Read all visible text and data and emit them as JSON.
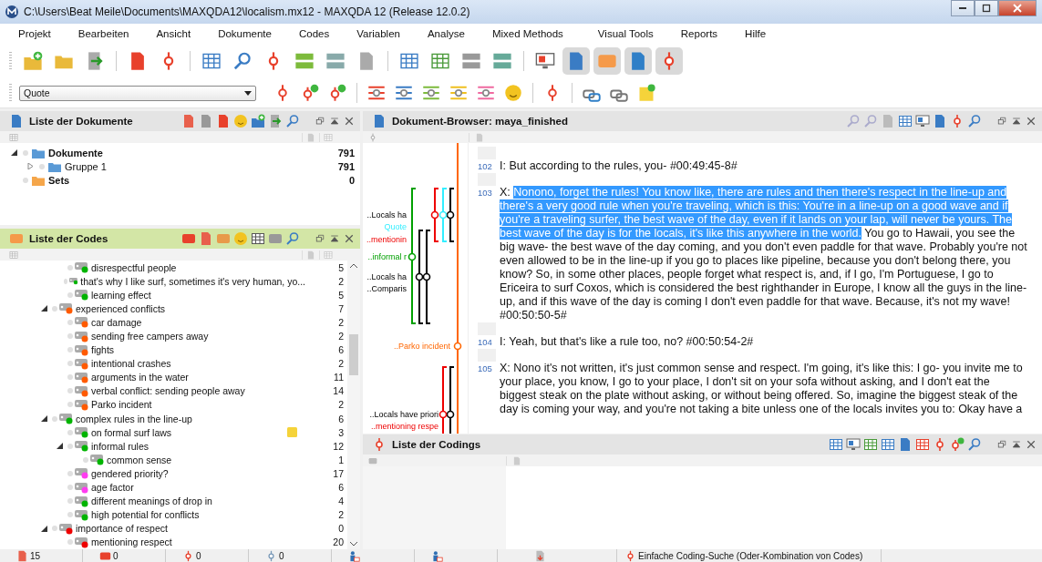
{
  "window": {
    "title": "C:\\Users\\Beat Meile\\Documents\\MAXQDA12\\localism.mx12 - MAXQDA 12  (Release 12.0.2)"
  },
  "menu": [
    "Projekt",
    "Bearbeiten",
    "Ansicht",
    "Dokumente",
    "Codes",
    "Variablen",
    "Analyse",
    "Mixed Methods",
    "Visual Tools",
    "Reports",
    "Hilfe"
  ],
  "toolbar": [
    {
      "pressed": false
    },
    {
      "pressed": false
    },
    {
      "pressed": false
    },
    {
      "pressed": false
    },
    {
      "pressed": false
    },
    {
      "pressed": false
    },
    {
      "pressed": false
    },
    {
      "pressed": false
    },
    {
      "pressed": false
    },
    {
      "pressed": false
    },
    {
      "pressed": false
    },
    {
      "pressed": false
    },
    {
      "pressed": false
    },
    {
      "pressed": false
    },
    {
      "pressed": false
    },
    {
      "pressed": false
    },
    {
      "pressed": true
    },
    {
      "pressed": true
    },
    {
      "pressed": true
    },
    {
      "pressed": true
    }
  ],
  "style_dropdown": {
    "value": "Quote"
  },
  "documents_panel": {
    "title": "Liste der Dokumente",
    "tree": [
      {
        "name": "Dokumente",
        "count": "791",
        "expanded": true,
        "children": [
          {
            "name": "Gruppe 1",
            "count": "791",
            "expanded": false
          }
        ]
      },
      {
        "name": "Sets",
        "count": "0"
      }
    ]
  },
  "codes_panel": {
    "title": "Liste der Codes",
    "leading_items": [
      {
        "name": "disrespectful people",
        "count": "5",
        "color": "#00b400",
        "memo": false
      },
      {
        "name": "that's why I like surf, sometimes it's very human, yo...",
        "count": "2",
        "color": "#00b400",
        "memo": false
      },
      {
        "name": "learning effect",
        "count": "5",
        "color": "#00b400",
        "memo": false
      }
    ],
    "tree": [
      {
        "name": "experienced conflicts",
        "count": "7",
        "color": "#ff5a00",
        "memo": false,
        "expanded": true,
        "children": [
          {
            "name": "car damage",
            "count": "2",
            "color": "#ff5a00",
            "memo": false
          },
          {
            "name": "sending free campers away",
            "count": "2",
            "color": "#ff5a00",
            "memo": false
          },
          {
            "name": "fights",
            "count": "6",
            "color": "#ff5a00",
            "memo": false
          },
          {
            "name": "intentional crashes",
            "count": "2",
            "color": "#ff5a00",
            "memo": false
          },
          {
            "name": "arguments in the water",
            "count": "11",
            "color": "#ff5a00",
            "memo": false
          },
          {
            "name": "verbal conflict: sending people away",
            "count": "14",
            "color": "#ff5a00",
            "memo": false
          },
          {
            "name": "Parko incident",
            "count": "2",
            "color": "#ff5a00",
            "memo": false
          }
        ]
      },
      {
        "name": "complex rules in the line-up",
        "count": "6",
        "color": "#00b400",
        "memo": false,
        "expanded": true,
        "children": [
          {
            "name": "on formal surf laws",
            "count": "3",
            "color": "#00b400",
            "memo": true
          },
          {
            "name": "informal rules",
            "count": "12",
            "color": "#00b400",
            "memo": false,
            "expanded": true,
            "children": [
              {
                "name": "common sense",
                "count": "1",
                "color": "#00b400",
                "memo": false
              }
            ]
          },
          {
            "name": "gendered priority?",
            "count": "17",
            "color": "#ff3cf0",
            "memo": false
          },
          {
            "name": "age factor",
            "count": "6",
            "color": "#ff3cf0",
            "memo": false
          },
          {
            "name": "different meanings of drop in",
            "count": "4",
            "color": "#00b400",
            "memo": false
          },
          {
            "name": "high potential for conflicts",
            "count": "2",
            "color": "#00b400",
            "memo": false
          }
        ]
      },
      {
        "name": "importance of respect",
        "count": "0",
        "color": "#ee0000",
        "memo": false,
        "expanded": true,
        "children": [
          {
            "name": "mentioning respect",
            "count": "20",
            "color": "#ee0000",
            "memo": false
          }
        ]
      }
    ]
  },
  "browser_panel": {
    "title": "Dokument-Browser: maya_finished",
    "coding_stripes": [
      {
        "label": "..Locals ha",
        "color": "#000000"
      },
      {
        "label": "Quote",
        "color": "#33eeff"
      },
      {
        "label": "..mentionin",
        "color": "#ee0000"
      },
      {
        "label": "..informal r",
        "color": "#00a000"
      },
      {
        "label": "..Locals ha",
        "color": "#000000"
      },
      {
        "label": "..Comparis",
        "color": "#000000"
      },
      {
        "label": "..Parko incident",
        "color": "#ff6600"
      },
      {
        "label": "..Locals have priori",
        "color": "#000000"
      },
      {
        "label": "..mentioning respe",
        "color": "#ee0000"
      }
    ],
    "paragraphs": [
      {
        "number": "102",
        "segments": [
          {
            "text": "I: But according to the rules, you- #00:49:45-8#",
            "selected": false
          }
        ]
      },
      {
        "number": "103",
        "segments": [
          {
            "text": "X: ",
            "selected": false
          },
          {
            "text": "Nonono, forget the rules! You know like, there are rules and then there's respect in the line-up and there's a very good rule when you're traveling, which is this: You're in a line-up on a good wave and if you're a traveling surfer, the best wave of the day, even if it lands on your lap, will never be yours. The best wave of the day is for the locals, it's like this anywhere in the world.",
            "selected": true
          },
          {
            "text": " You go to Hawaii, you see the big wave- the best wave of the day coming, and you don't even paddle for that wave. Probably you're not even allowed to be in the line-up if you go to places like pipeline, because you don't belong there, you know? So, in some other places, people forget what respect is, and, if I go, I'm Portuguese, I go to Ericeira to surf Coxos, which is considered the best righthander in Europe, I know all the guys in the line-up, and if this wave of the day is coming I don't even paddle for that wave. Because, it's not my wave! #00:50:50-5#",
            "selected": false
          }
        ]
      },
      {
        "number": "104",
        "segments": [
          {
            "text": "I: Yeah, but that's like a rule too, no? #00:50:54-2#",
            "selected": false
          }
        ]
      },
      {
        "number": "105",
        "segments": [
          {
            "text": "X: Nono it's not written, it's just common sense and respect. I'm going, it's like this: I go- you invite me to your place, you know, I go to your place, I don't sit on your sofa without asking, and I don't eat the biggest steak on the plate without asking, or without being offered. So, imagine the biggest steak of the day is coming your way, and you're not taking a bite unless one of the locals invites you to: Okay have a",
            "selected": false
          }
        ]
      }
    ]
  },
  "codings_panel": {
    "title": "Liste der Codings"
  },
  "status_bar": {
    "documents": "15",
    "codes": "0",
    "codings": "0",
    "activated": "0",
    "search_mode": "Einfache Coding-Suche (Oder-Kombination von Codes)"
  }
}
